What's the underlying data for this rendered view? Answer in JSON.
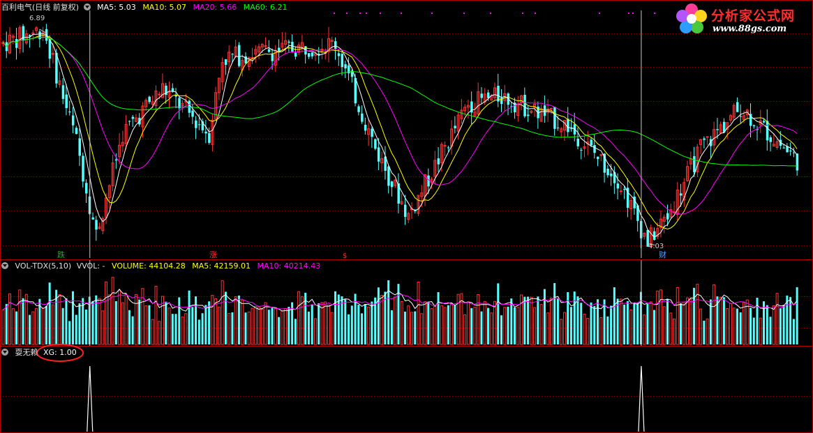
{
  "main_panel": {
    "stock_name": "百利电气(日线 前复权)",
    "ma_labels": [
      {
        "text": "MA5: 5.03",
        "color": "#ffffff"
      },
      {
        "text": "MA10: 5.07",
        "color": "#ffff00"
      },
      {
        "text": "MA20: 5.66",
        "color": "#ff00ff"
      },
      {
        "text": "MA60: 6.21",
        "color": "#00ff00"
      }
    ],
    "high_label": "6.89",
    "low_label": "4.03",
    "signal_marks": [
      {
        "text": "跌",
        "color": "#00c000"
      },
      {
        "text": "涨",
        "color": "#ff3030"
      },
      {
        "text": "$",
        "color": "#ff3030"
      },
      {
        "text": "财",
        "color": "#4fa0ff"
      }
    ]
  },
  "volume_panel": {
    "indicator": "VOL-TDX(5,10)",
    "vvol": "VVOL: -",
    "volume": "VOLUME: 44104.28",
    "ma5": "MA5: 42159.01",
    "ma10": "MA10: 40214.43"
  },
  "indicator_panel": {
    "name": "耍无赖",
    "xg": "XG: 1.00"
  },
  "logo": {
    "title": "分析家公式网",
    "url": "www.88gs.com"
  },
  "colors": {
    "up": "#ff3232",
    "down": "#54ffff",
    "ma5": "#ffffff",
    "ma10": "#ffff00",
    "ma20": "#ff00ff",
    "ma60": "#00ff00",
    "grid": "#8b0000",
    "border": "#b00000",
    "highlight_circle": "#ff2020"
  },
  "chart_data": {
    "type": "candlestick",
    "title": "百利电气(日线 前复权)",
    "price_high": 6.89,
    "price_low": 4.03,
    "ma_latest": {
      "MA5": 5.03,
      "MA10": 5.07,
      "MA20": 5.66,
      "MA60": 6.21
    },
    "volume_latest": {
      "VOLUME": 44104.28,
      "MA5": 42159.01,
      "MA10": 40214.43
    },
    "xg_latest": 1.0,
    "xg_signal_count": 2,
    "series_summary": [
      {
        "phase": "start",
        "approx_price": 6.7
      },
      {
        "phase": "first_drop_low",
        "approx_price": 4.2
      },
      {
        "phase": "rebound_high",
        "approx_price": 6.7
      },
      {
        "phase": "mid_range",
        "approx_price": 6.0
      },
      {
        "phase": "decline",
        "approx_price": 5.0
      },
      {
        "phase": "recovery",
        "approx_price": 5.8
      },
      {
        "phase": "low",
        "approx_price": 4.03
      },
      {
        "phase": "end",
        "approx_price": 5.1
      }
    ]
  }
}
